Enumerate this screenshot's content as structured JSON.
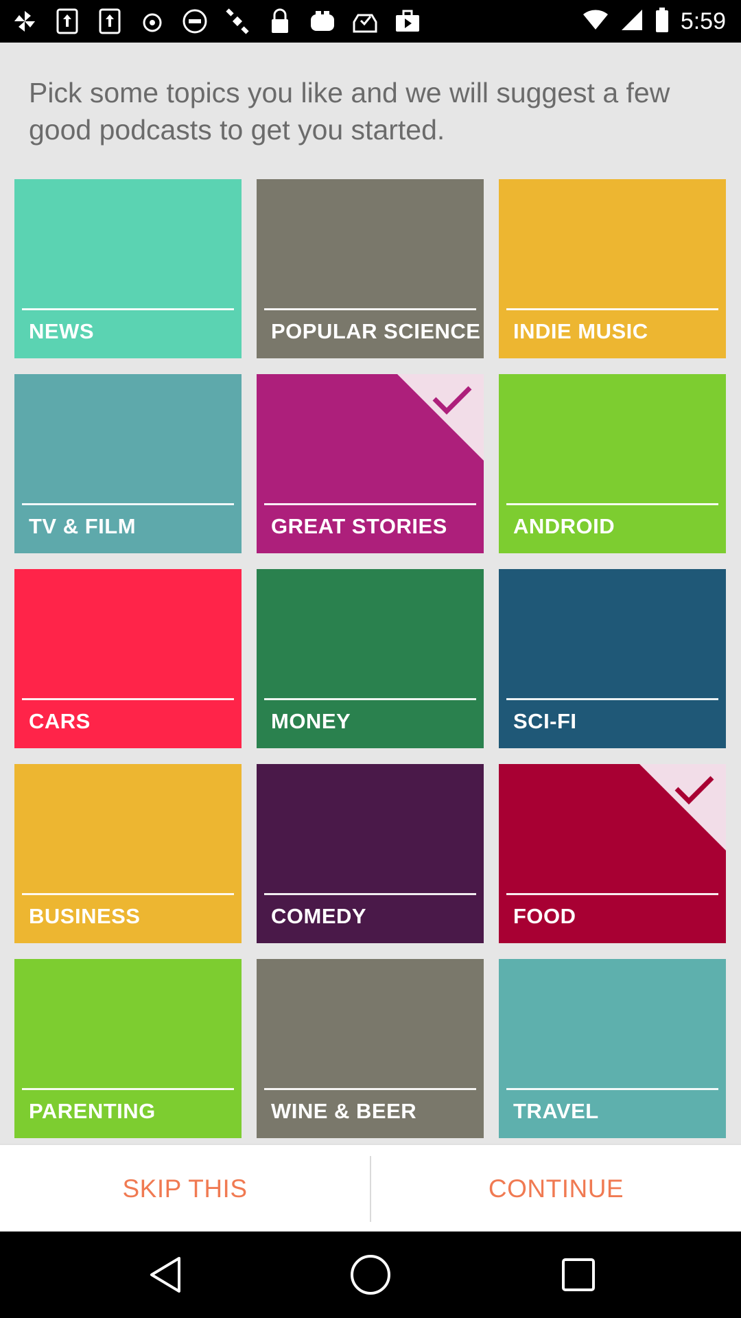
{
  "status_bar": {
    "time": "5:59",
    "icons": [
      "pinwheel-icon",
      "tablet-upload-icon",
      "tablet-upload-icon",
      "fake-gps-icon",
      "no-entry-icon",
      "satellite-icon",
      "lock-icon",
      "toaster-icon",
      "inbox-check-icon",
      "briefcase-play-icon"
    ]
  },
  "intro": {
    "text": "Pick some topics you like and we will suggest a few good podcasts to get you started."
  },
  "topics": [
    {
      "label": "NEWS",
      "color": "#5bd3b2",
      "selected": false
    },
    {
      "label": "POPULAR SCIENCE",
      "color": "#7a786b",
      "selected": false
    },
    {
      "label": "INDIE MUSIC",
      "color": "#edb631",
      "selected": false
    },
    {
      "label": "TV & FILM",
      "color": "#5ea9ab",
      "selected": false
    },
    {
      "label": "GREAT STORIES",
      "color": "#ad1f7b",
      "selected": true
    },
    {
      "label": "ANDROID",
      "color": "#7dcd30",
      "selected": false
    },
    {
      "label": "CARS",
      "color": "#ff2449",
      "selected": false
    },
    {
      "label": "MONEY",
      "color": "#2a814e",
      "selected": false
    },
    {
      "label": "SCI-FI",
      "color": "#1f5877",
      "selected": false
    },
    {
      "label": "BUSINESS",
      "color": "#edb631",
      "selected": false
    },
    {
      "label": "COMEDY",
      "color": "#4a1949",
      "selected": false
    },
    {
      "label": "FOOD",
      "color": "#a80033",
      "selected": true
    },
    {
      "label": "PARENTING",
      "color": "#7dcd30",
      "selected": false
    },
    {
      "label": "WINE & BEER",
      "color": "#7a786b",
      "selected": false
    },
    {
      "label": "TRAVEL",
      "color": "#5eb0ad",
      "selected": false
    }
  ],
  "actions": {
    "skip_label": "SKIP THIS",
    "continue_label": "CONTINUE",
    "accent": "#f07a52"
  },
  "nav": {
    "back": "back-triangle-icon",
    "home": "home-circle-icon",
    "recents": "recents-square-icon"
  }
}
